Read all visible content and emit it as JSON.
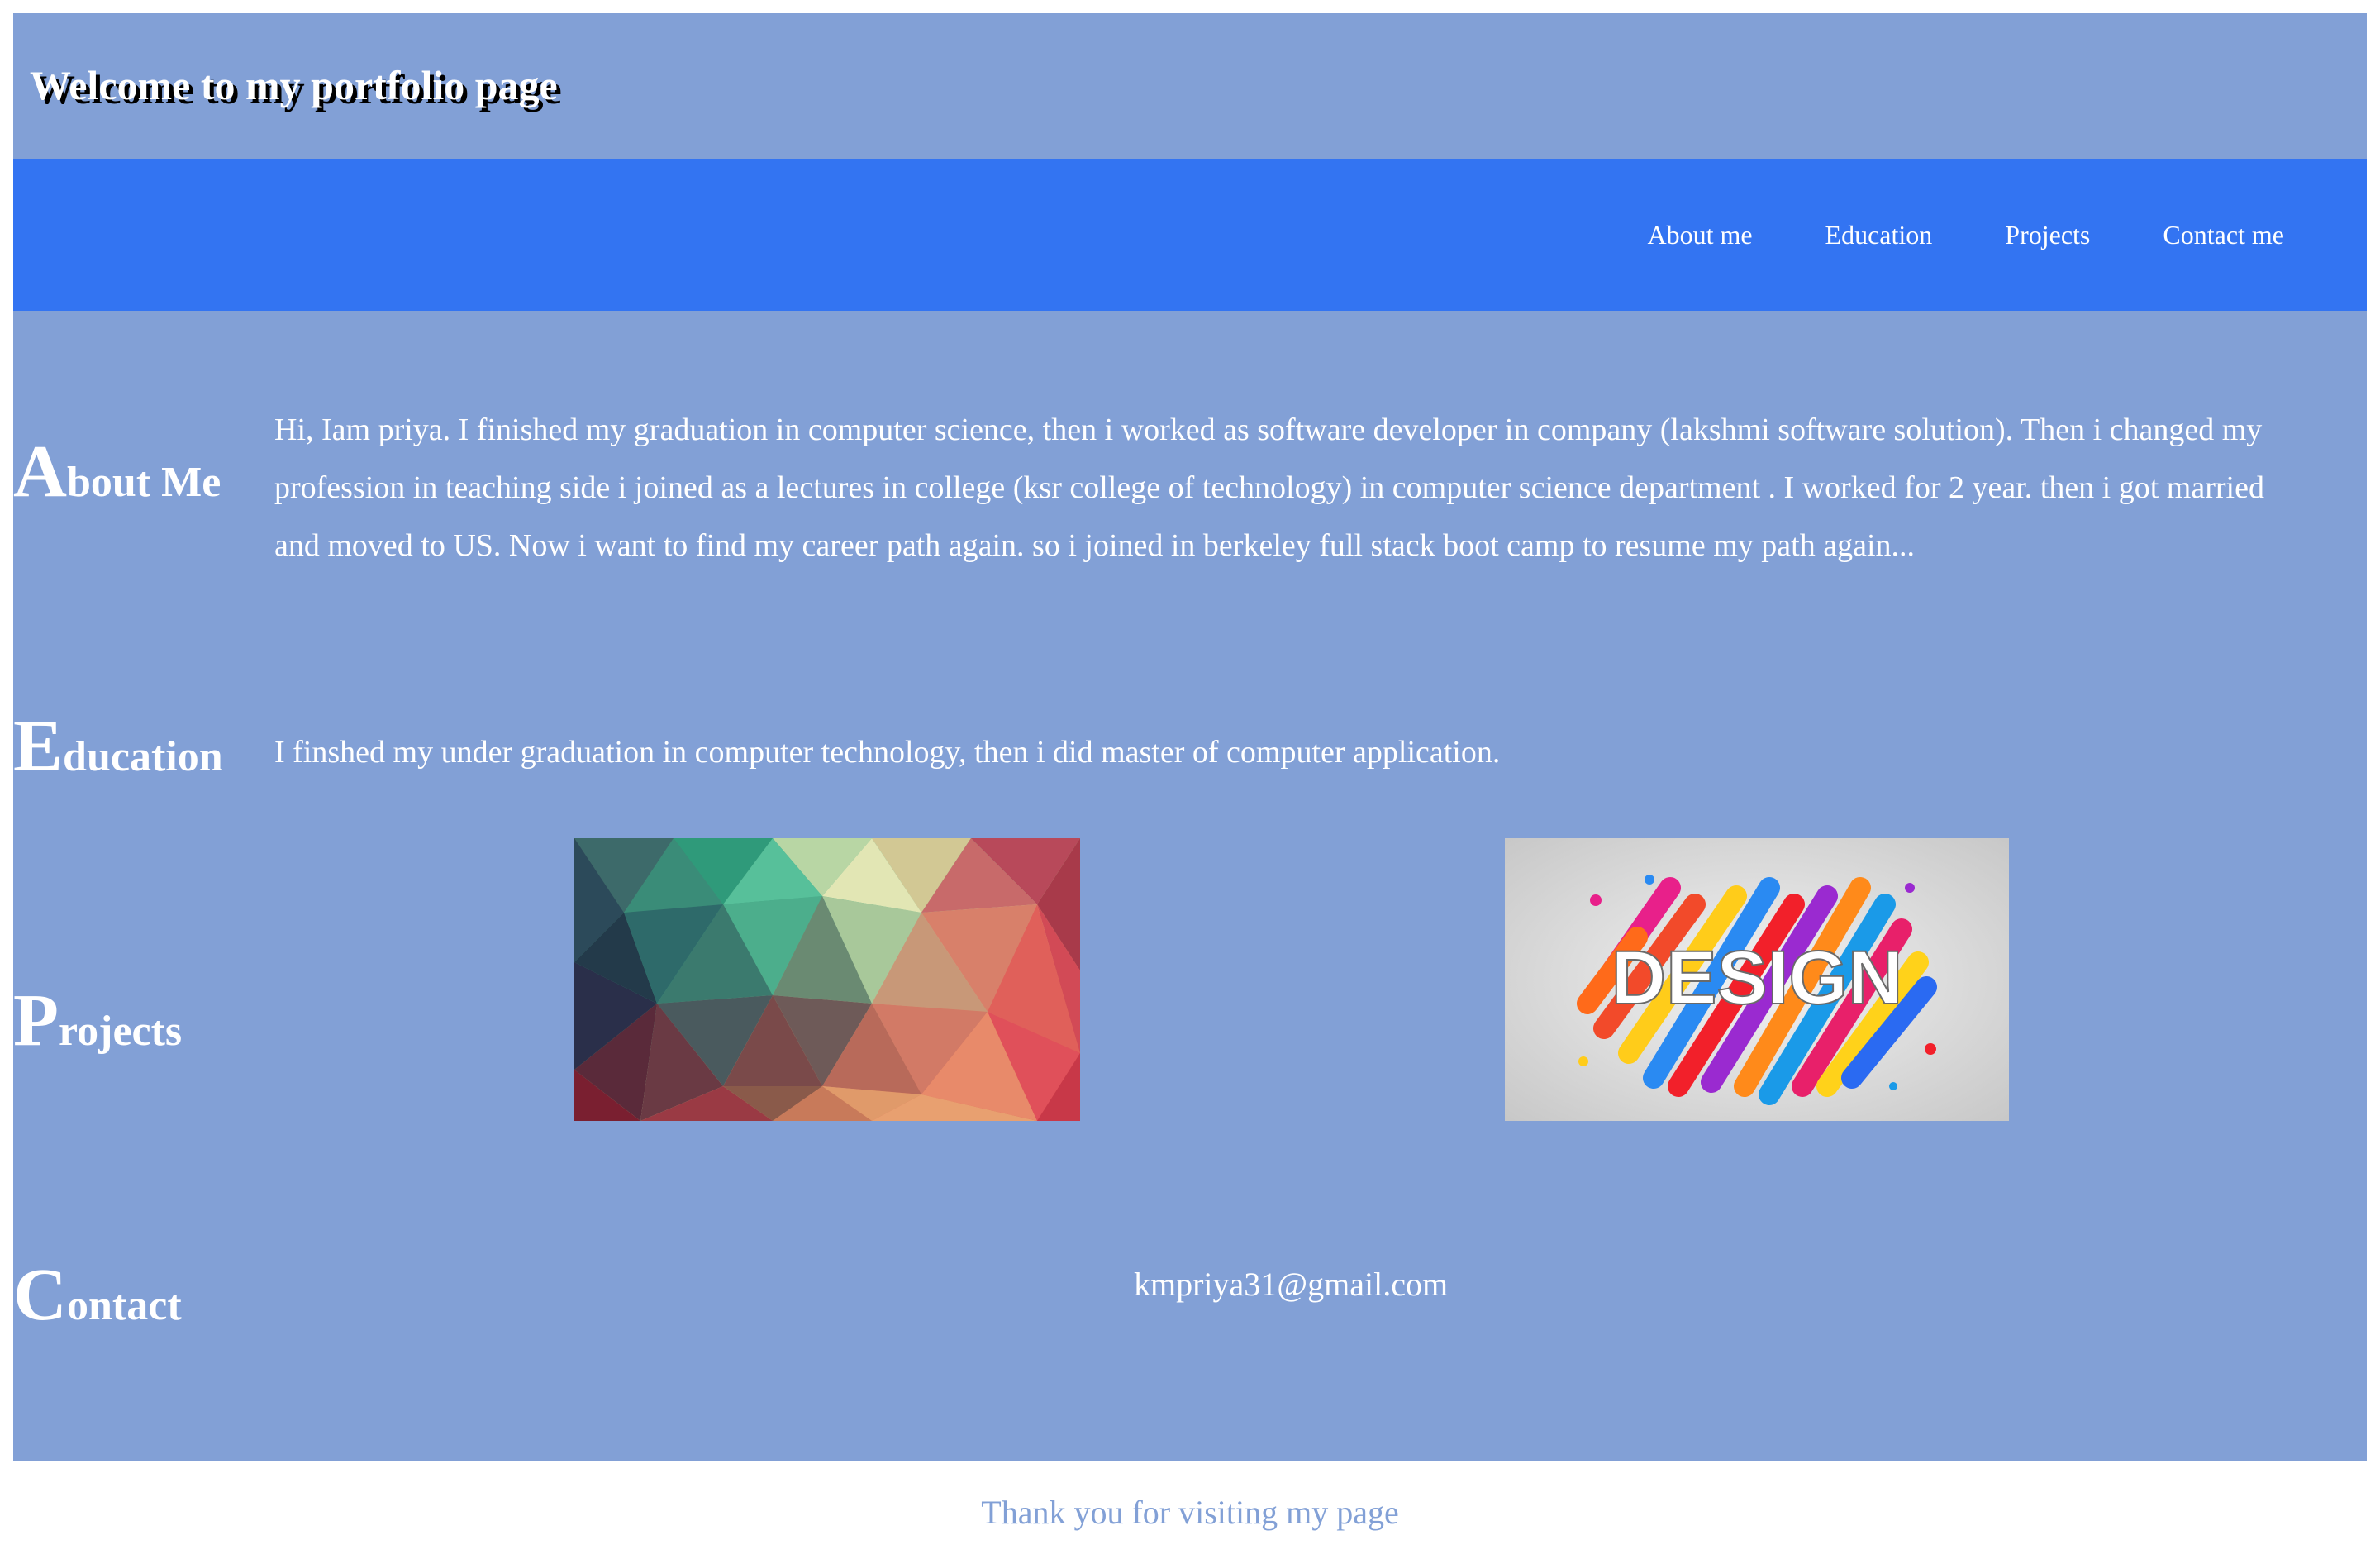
{
  "header": {
    "title": "Welcome to my portfolio page"
  },
  "nav": {
    "items": [
      {
        "label": "About me"
      },
      {
        "label": "Education"
      },
      {
        "label": "Projects"
      },
      {
        "label": "Contact me"
      }
    ]
  },
  "about": {
    "heading_initial": "A",
    "heading_rest": "bout Me",
    "text": "Hi, Iam priya. I finished my graduation in computer science, then i worked as software developer in company (lakshmi software solution). Then i changed my profession in teaching side i joined as a lectures in college (ksr college of technology) in computer science department . I worked for 2 year. then i got married and moved to US. Now i want to find my career path again. so i joined in berkeley full stack boot camp to resume my path again..."
  },
  "education": {
    "heading_initial": "E",
    "heading_rest": "ducation",
    "text": "I finshed my under graduation in computer technology, then i did master of computer application."
  },
  "projects": {
    "heading_initial": "P",
    "heading_rest": "rojects",
    "images": [
      {
        "kind": "abstract-polygon-image"
      },
      {
        "kind": "design-banner-image",
        "text": "DESIGN"
      }
    ]
  },
  "contact": {
    "heading_initial": "C",
    "heading_rest": "ontact",
    "email": "kmpriya31@gmail.com"
  },
  "footer": {
    "text": "Thank you for visiting my page"
  },
  "colors": {
    "page_background": "#82a0d6",
    "navbar_background": "#3374f2",
    "text": "#ffffff",
    "footer_text": "#82a0d6"
  }
}
